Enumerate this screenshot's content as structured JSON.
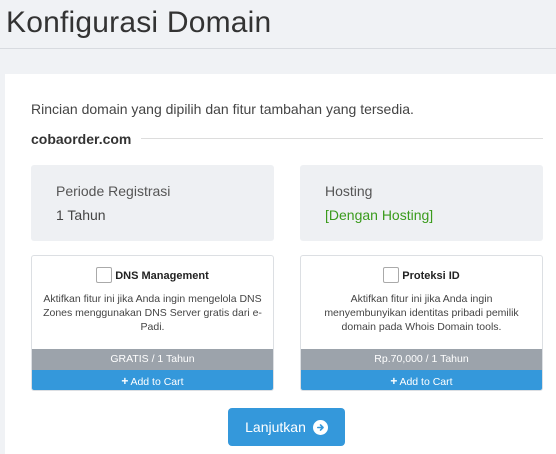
{
  "page": {
    "title": "Konfigurasi Domain"
  },
  "intro": "Rincian domain yang dipilih dan fitur tambahan yang tersedia.",
  "domain": {
    "name": "cobaorder.com"
  },
  "registration": {
    "label": "Periode Registrasi",
    "value": "1 Tahun"
  },
  "hosting": {
    "label": "Hosting",
    "value": "[Dengan Hosting]",
    "value_color": "#3a9b1c"
  },
  "addons": [
    {
      "name": "DNS Management",
      "description": "Aktifkan fitur ini jika Anda ingin mengelola DNS Zones menggunakan DNS Server gratis dari e-Padi.",
      "price": "GRATIS / 1 Tahun",
      "cart_label": "Add to Cart",
      "checked": false
    },
    {
      "name": "Proteksi ID",
      "description": "Aktifkan fitur ini jika Anda ingin menyembunyikan identitas pribadi pemilik domain pada Whois Domain tools.",
      "price": "Rp.70,000 / 1 Tahun",
      "cart_label": "Add to Cart",
      "checked": false
    }
  ],
  "continue_button": {
    "label": "Lanjutkan",
    "icon": "arrow-circle-right-icon"
  },
  "colors": {
    "accent": "#3498db",
    "price_bar": "#9ca3ab",
    "success": "#3a9b1c"
  }
}
